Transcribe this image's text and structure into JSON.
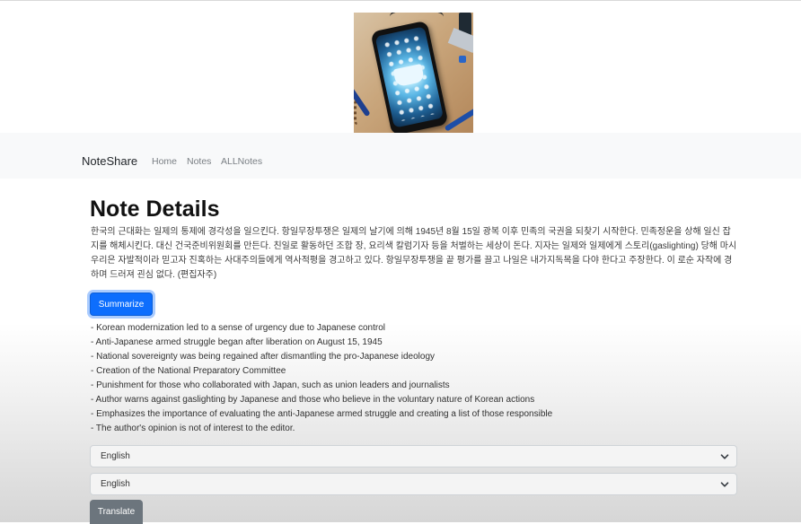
{
  "hero_image": {
    "icon": "phone-with-book-illustration"
  },
  "navbar": {
    "brand": "NoteShare",
    "links": [
      "Home",
      "Notes",
      "ALLNotes"
    ]
  },
  "page": {
    "title": "Note Details",
    "note_text": "한국의 근대화는 일제의 통제에 경각성을 일으킨다. 항일무장투쟁은 일제의 날기에 의해 1945년 8월 15일 광복 이후 민족의 국권을 되찾기 시작한다. 민족정운을 상해 일신 잡지를 해체시킨다. 대신 건국준비위원회를 만든다. 친일로 활동하던 조합 장, 요리색 칼럼기자 등을 처벌하는 세상이 돈다. 지자는 일제와 일제에게 스토리(gaslighting) 당해 마시 우리은 자발적이라 믿고자 진혹하는 사대주의들에게 역사적평을 경고하고 있다. 항일무장투쟁을 끝 평가를 끌고 나일은 내가지독목을 다야 한다고 주장한다. 이 로순 자작에 경하며 드러져 괸심 없다. (편집자주)",
    "summarize_label": "Summarize",
    "summary_lines": [
      "- Korean modernization led to a sense of urgency due to Japanese control",
      "- Anti-Japanese armed struggle began after liberation on August 15, 1945",
      "- National sovereignty was being regained after dismantling the pro-Japanese ideology",
      "- Creation of the National Preparatory Committee",
      "- Punishment for those who collaborated with Japan, such as union leaders and journalists",
      "- Author warns against gaslighting by Japanese and those who believe in the voluntary nature of Korean actions",
      "- Emphasizes the importance of evaluating the anti-Japanese armed struggle and creating a list of those responsible",
      "- The author's opinion is not of interest to the editor."
    ],
    "source_language": "English",
    "target_language": "English",
    "translate_label": "Translate"
  },
  "colors": {
    "primary": "#0d6efd",
    "secondary": "#6c757d",
    "navbar_bg": "#f8f9fa"
  }
}
